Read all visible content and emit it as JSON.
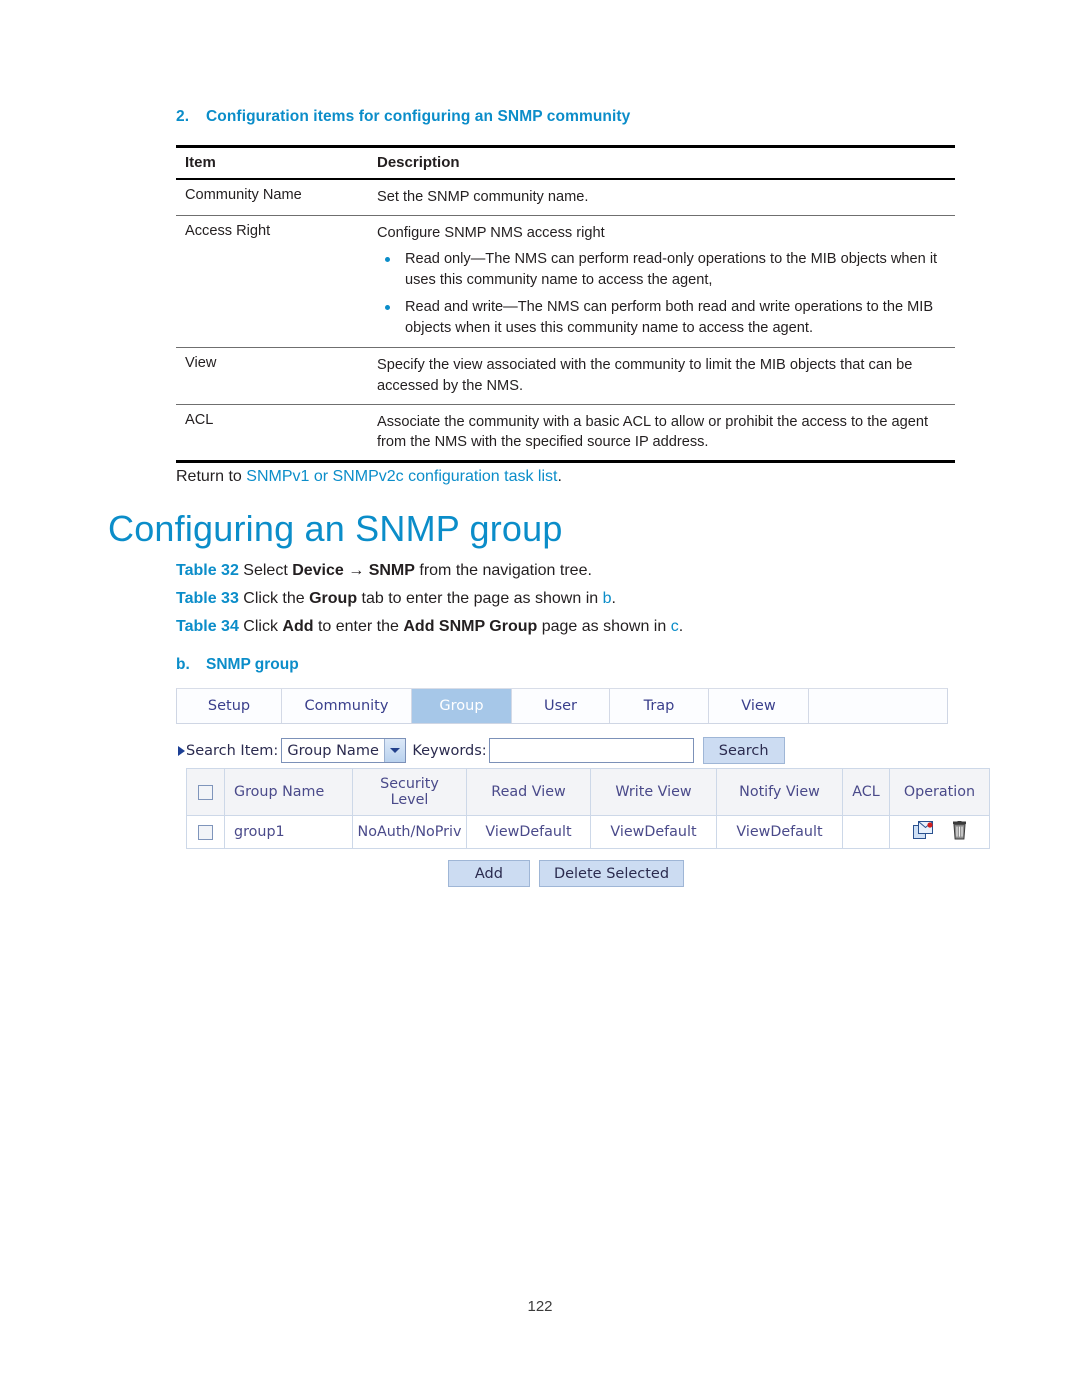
{
  "section": {
    "number": "2.",
    "title": "Configuration items for configuring an SNMP community"
  },
  "doc_table": {
    "headers": [
      "Item",
      "Description"
    ],
    "rows": [
      {
        "item": "Community Name",
        "desc_lead": "Set the SNMP community name.",
        "bullets": []
      },
      {
        "item": "Access Right",
        "desc_lead": "Configure SNMP NMS access right",
        "bullets": [
          "Read only—The NMS can perform read-only operations to the MIB objects when it uses this community name to access the agent,",
          "Read and write—The NMS can perform both read and write operations to the MIB objects when it uses this community name to access the agent."
        ]
      },
      {
        "item": "View",
        "desc_lead": "Specify the view associated with the community to limit the MIB objects that can be accessed by the NMS.",
        "bullets": []
      },
      {
        "item": "ACL",
        "desc_lead": "Associate the community with a basic ACL to allow or prohibit the access to the agent from the NMS with the specified source IP address.",
        "bullets": []
      }
    ]
  },
  "return_line": {
    "prefix": "Return to ",
    "link": "SNMPv1 or SNMPv2c configuration task list",
    "suffix": "."
  },
  "heading": "Configuring an SNMP group",
  "steps": [
    {
      "tag": "Table 32",
      "parts": [
        {
          "t": " Select ",
          "b": false
        },
        {
          "t": "Device",
          "b": true
        },
        {
          "t": " → ",
          "b": false
        },
        {
          "t": "SNMP",
          "b": true
        },
        {
          "t": " from the navigation tree.",
          "b": false
        }
      ]
    },
    {
      "tag": "Table 33",
      "parts": [
        {
          "t": " Click the ",
          "b": false
        },
        {
          "t": "Group",
          "b": true
        },
        {
          "t": " tab to enter the page as shown in ",
          "b": false
        },
        {
          "t": "b",
          "b": false,
          "link": true
        },
        {
          "t": ".",
          "b": false
        }
      ]
    },
    {
      "tag": "Table 34",
      "parts": [
        {
          "t": " Click ",
          "b": false
        },
        {
          "t": "Add",
          "b": true
        },
        {
          "t": " to enter the ",
          "b": false
        },
        {
          "t": "Add SNMP Group",
          "b": true
        },
        {
          "t": " page as shown in ",
          "b": false
        },
        {
          "t": "c",
          "b": false,
          "link": true
        },
        {
          "t": ".",
          "b": false
        }
      ]
    }
  ],
  "subcaption": {
    "letter": "b.",
    "title": "SNMP group"
  },
  "ui": {
    "tabs": [
      {
        "label": "Setup",
        "active": false
      },
      {
        "label": "Community",
        "active": false
      },
      {
        "label": "Group",
        "active": true
      },
      {
        "label": "User",
        "active": false
      },
      {
        "label": "Trap",
        "active": false
      },
      {
        "label": "View",
        "active": false
      }
    ],
    "search": {
      "item_label": "Search Item:",
      "selected": "Group Name",
      "keywords_label": "Keywords:",
      "keywords_value": "",
      "keywords_placeholder": "",
      "button": "Search"
    },
    "grid": {
      "headers": {
        "checkbox": "",
        "group_name": "Group Name",
        "security_level_line1": "Security",
        "security_level_line2": "Level",
        "read_view": "Read View",
        "write_view": "Write View",
        "notify_view": "Notify View",
        "acl": "ACL",
        "operation": "Operation"
      },
      "rows": [
        {
          "group_name": "group1",
          "security_level": "NoAuth/NoPriv",
          "read_view": "ViewDefault",
          "write_view": "ViewDefault",
          "notify_view": "ViewDefault",
          "acl": "",
          "operation_icons": [
            "edit-icon",
            "delete-icon"
          ]
        }
      ]
    },
    "buttons": {
      "add": "Add",
      "delete_selected": "Delete Selected"
    }
  },
  "page_number": "122",
  "colors": {
    "accent_blue": "#0b8dc9",
    "tab_active_bg": "#a6c7e8",
    "grid_link": "#4a47cf",
    "button_bg": "#ccdcf2"
  }
}
